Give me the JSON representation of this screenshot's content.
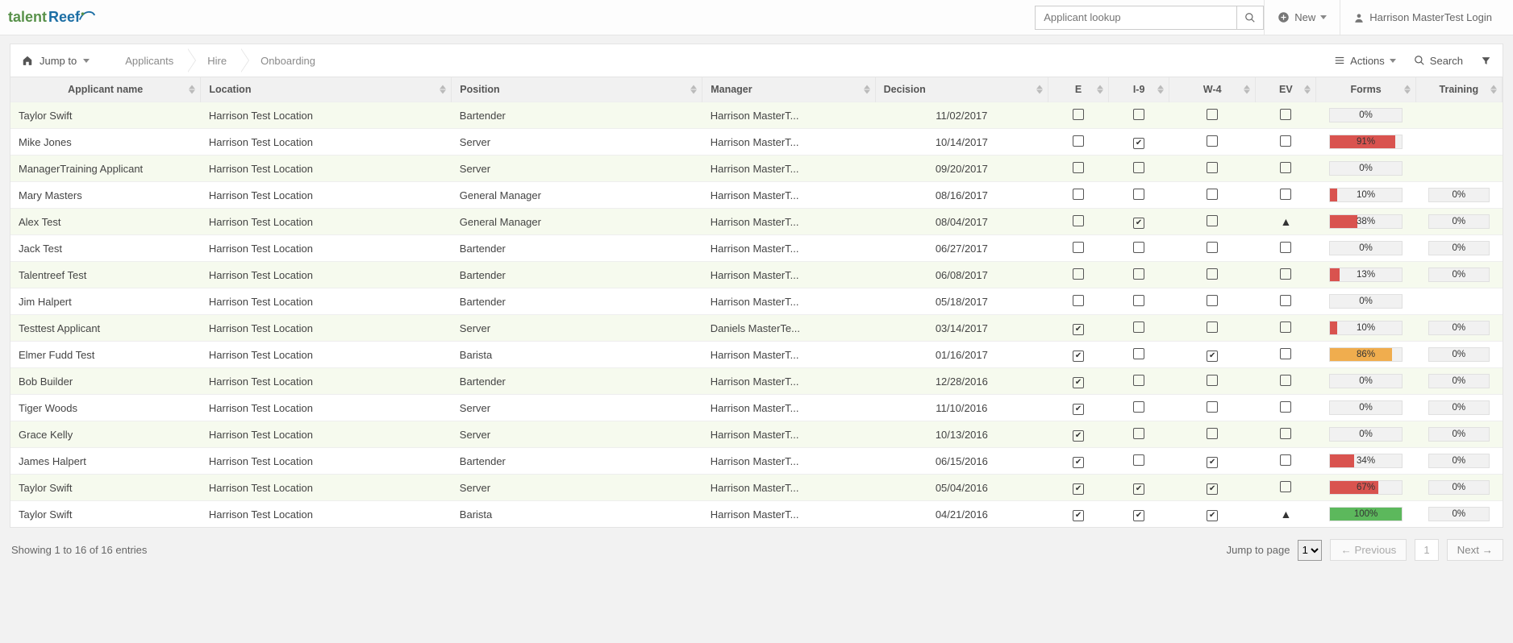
{
  "top": {
    "brand_left": "talent",
    "brand_right": "Reef",
    "search_placeholder": "Applicant lookup",
    "new_label": "New",
    "user_label": "Harrison MasterTest Login"
  },
  "toolbar": {
    "jump_label": "Jump to",
    "crumbs": [
      "Applicants",
      "Hire",
      "Onboarding"
    ],
    "actions_label": "Actions",
    "search_label": "Search"
  },
  "columns": [
    "Applicant name",
    "Location",
    "Position",
    "Manager",
    "Decision",
    "E",
    "I-9",
    "W-4",
    "EV",
    "Forms",
    "Training"
  ],
  "rows": [
    {
      "name": "Taylor Swift",
      "loc": "Harrison Test Location",
      "pos": "Bartender",
      "mgr": "Harrison MasterT...",
      "dec": "11/02/2017",
      "e": false,
      "i9": false,
      "w4": false,
      "ev": "box",
      "forms": {
        "pct": 0,
        "color": "none"
      },
      "train": null
    },
    {
      "name": "Mike Jones",
      "loc": "Harrison Test Location",
      "pos": "Server",
      "mgr": "Harrison MasterT...",
      "dec": "10/14/2017",
      "e": false,
      "i9": true,
      "w4": false,
      "ev": "box",
      "forms": {
        "pct": 91,
        "color": "red"
      },
      "train": null
    },
    {
      "name": "ManagerTraining Applicant",
      "loc": "Harrison Test Location",
      "pos": "Server",
      "mgr": "Harrison MasterT...",
      "dec": "09/20/2017",
      "e": false,
      "i9": false,
      "w4": false,
      "ev": "box",
      "forms": {
        "pct": 0,
        "color": "none"
      },
      "train": null
    },
    {
      "name": "Mary Masters",
      "loc": "Harrison Test Location",
      "pos": "General Manager",
      "mgr": "Harrison MasterT...",
      "dec": "08/16/2017",
      "e": false,
      "i9": false,
      "w4": false,
      "ev": "box",
      "forms": {
        "pct": 10,
        "color": "red"
      },
      "train": 0
    },
    {
      "name": "Alex Test",
      "loc": "Harrison Test Location",
      "pos": "General Manager",
      "mgr": "Harrison MasterT...",
      "dec": "08/04/2017",
      "e": false,
      "i9": true,
      "w4": false,
      "ev": "warn",
      "forms": {
        "pct": 38,
        "color": "red"
      },
      "train": 0
    },
    {
      "name": "Jack Test",
      "loc": "Harrison Test Location",
      "pos": "Bartender",
      "mgr": "Harrison MasterT...",
      "dec": "06/27/2017",
      "e": false,
      "i9": false,
      "w4": false,
      "ev": "box",
      "forms": {
        "pct": 0,
        "color": "none"
      },
      "train": 0
    },
    {
      "name": "Talentreef Test",
      "loc": "Harrison Test Location",
      "pos": "Bartender",
      "mgr": "Harrison MasterT...",
      "dec": "06/08/2017",
      "e": false,
      "i9": false,
      "w4": false,
      "ev": "box",
      "forms": {
        "pct": 13,
        "color": "red"
      },
      "train": 0
    },
    {
      "name": "Jim Halpert",
      "loc": "Harrison Test Location",
      "pos": "Bartender",
      "mgr": "Harrison MasterT...",
      "dec": "05/18/2017",
      "e": false,
      "i9": false,
      "w4": false,
      "ev": "box",
      "forms": {
        "pct": 0,
        "color": "none"
      },
      "train": null
    },
    {
      "name": "Testtest Applicant",
      "loc": "Harrison Test Location",
      "pos": "Server",
      "mgr": "Daniels MasterTe...",
      "dec": "03/14/2017",
      "e": true,
      "i9": false,
      "w4": false,
      "ev": "box",
      "forms": {
        "pct": 10,
        "color": "red"
      },
      "train": 0
    },
    {
      "name": "Elmer Fudd Test",
      "loc": "Harrison Test Location",
      "pos": "Barista",
      "mgr": "Harrison MasterT...",
      "dec": "01/16/2017",
      "e": true,
      "i9": false,
      "w4": true,
      "ev": "box",
      "forms": {
        "pct": 86,
        "color": "orange"
      },
      "train": 0
    },
    {
      "name": "Bob Builder",
      "loc": "Harrison Test Location",
      "pos": "Bartender",
      "mgr": "Harrison MasterT...",
      "dec": "12/28/2016",
      "e": true,
      "i9": false,
      "w4": false,
      "ev": "box",
      "forms": {
        "pct": 0,
        "color": "none"
      },
      "train": 0
    },
    {
      "name": "Tiger Woods",
      "loc": "Harrison Test Location",
      "pos": "Server",
      "mgr": "Harrison MasterT...",
      "dec": "11/10/2016",
      "e": true,
      "i9": false,
      "w4": false,
      "ev": "box",
      "forms": {
        "pct": 0,
        "color": "none"
      },
      "train": 0
    },
    {
      "name": "Grace Kelly",
      "loc": "Harrison Test Location",
      "pos": "Server",
      "mgr": "Harrison MasterT...",
      "dec": "10/13/2016",
      "e": true,
      "i9": false,
      "w4": false,
      "ev": "box",
      "forms": {
        "pct": 0,
        "color": "none"
      },
      "train": 0
    },
    {
      "name": "James Halpert",
      "loc": "Harrison Test Location",
      "pos": "Bartender",
      "mgr": "Harrison MasterT...",
      "dec": "06/15/2016",
      "e": true,
      "i9": false,
      "w4": true,
      "ev": "box",
      "forms": {
        "pct": 34,
        "color": "red"
      },
      "train": 0
    },
    {
      "name": "Taylor Swift",
      "loc": "Harrison Test Location",
      "pos": "Server",
      "mgr": "Harrison MasterT...",
      "dec": "05/04/2016",
      "e": true,
      "i9": true,
      "w4": true,
      "ev": "box",
      "forms": {
        "pct": 67,
        "color": "red"
      },
      "train": 0
    },
    {
      "name": "Taylor Swift",
      "loc": "Harrison Test Location",
      "pos": "Barista",
      "mgr": "Harrison MasterT...",
      "dec": "04/21/2016",
      "e": true,
      "i9": true,
      "w4": true,
      "ev": "warn",
      "forms": {
        "pct": 100,
        "color": "green"
      },
      "train": 0
    }
  ],
  "footer": {
    "summary": "Showing 1 to 16 of 16 entries",
    "jump_label": "Jump to page",
    "page_value": "1",
    "prev": "← Previous",
    "current": "1",
    "next": "Next →"
  }
}
